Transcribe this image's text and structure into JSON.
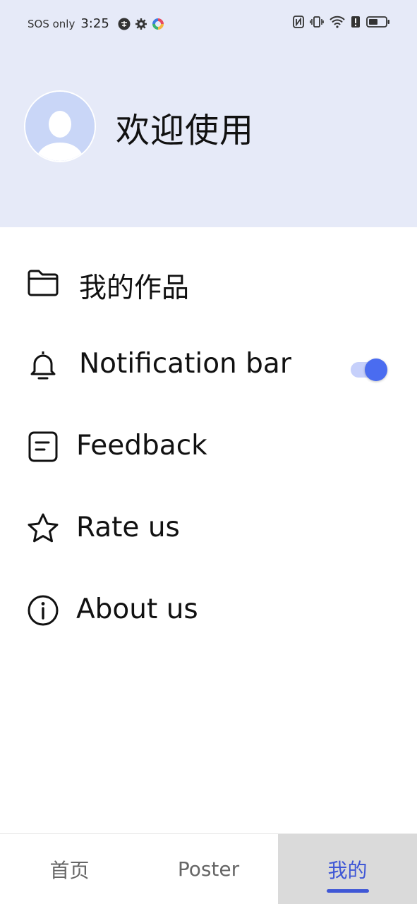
{
  "status_bar": {
    "carrier": "SOS only",
    "time": "3:25"
  },
  "header": {
    "welcome": "欢迎使用"
  },
  "menu": {
    "items": [
      {
        "label": "我的作品",
        "icon": "folder-icon"
      },
      {
        "label": "Notification bar",
        "icon": "bell-icon",
        "toggle": true
      },
      {
        "label": "Feedback",
        "icon": "document-icon"
      },
      {
        "label": "Rate us",
        "icon": "star-icon"
      },
      {
        "label": "About us",
        "icon": "info-icon"
      }
    ]
  },
  "bottom_nav": {
    "tabs": [
      {
        "label": "首页"
      },
      {
        "label": "Poster"
      },
      {
        "label": "我的",
        "active": true
      }
    ]
  },
  "colors": {
    "header_bg": "#e6eaf8",
    "accent": "#4a6cf0",
    "active_tab_bg": "#dadada"
  }
}
